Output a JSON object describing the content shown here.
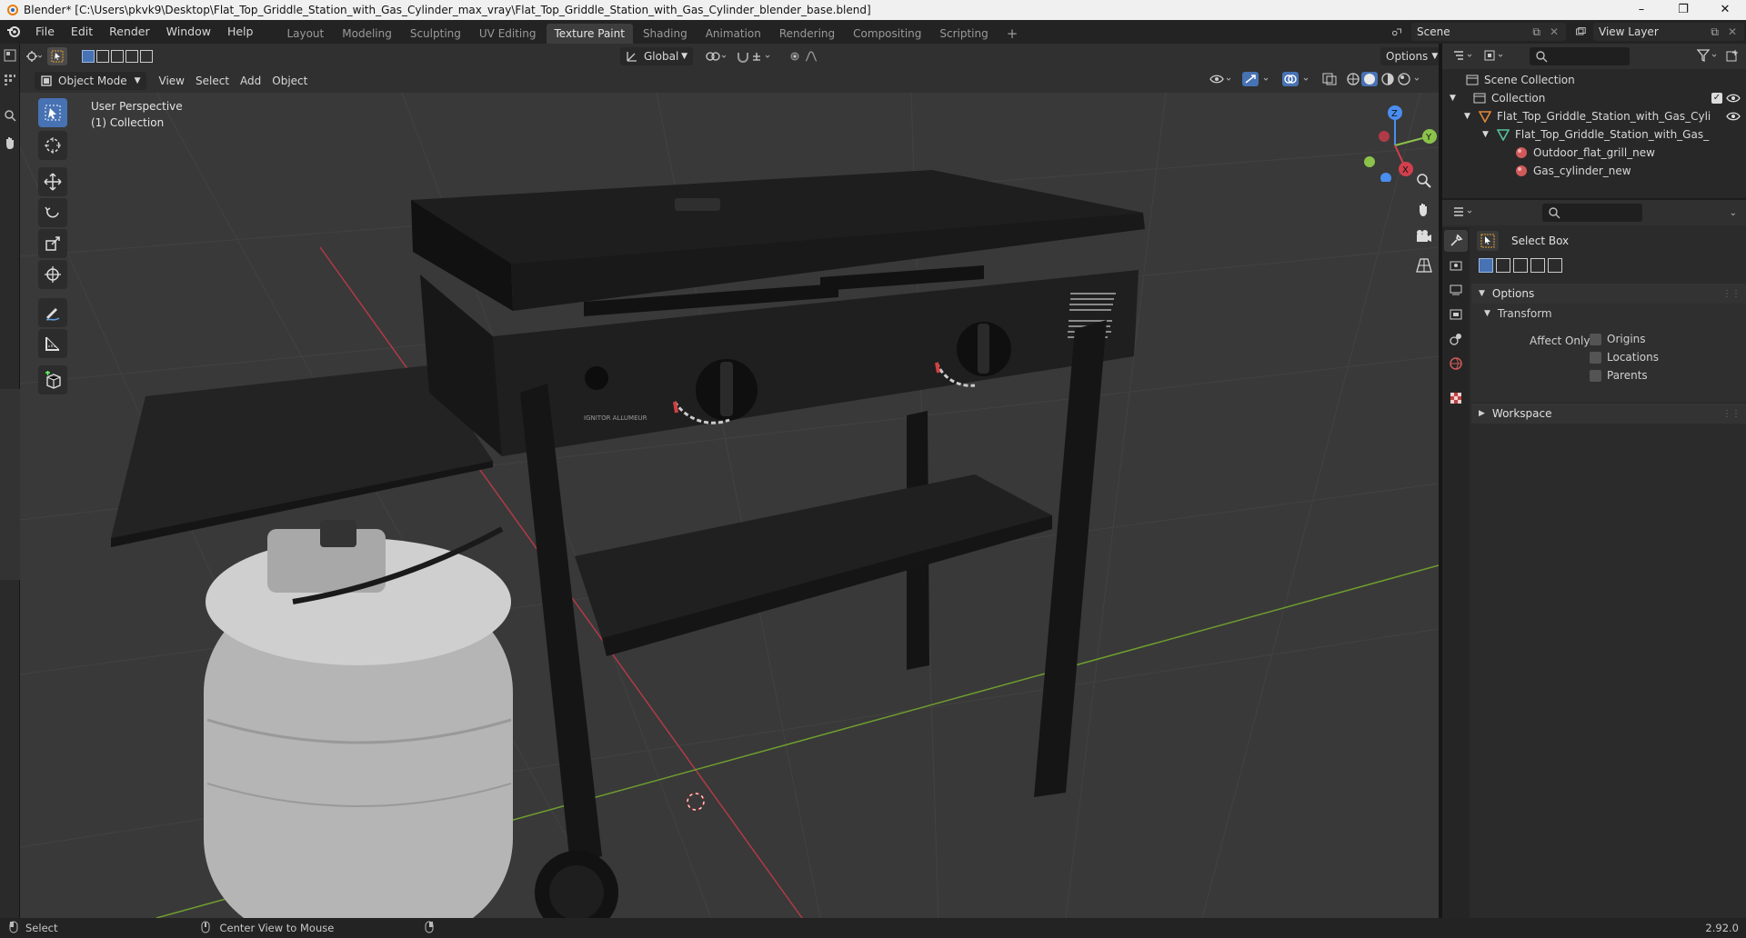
{
  "window": {
    "title": "Blender* [C:\\Users\\pkvk9\\Desktop\\Flat_Top_Griddle_Station_with_Gas_Cylinder_max_vray\\Flat_Top_Griddle_Station_with_Gas_Cylinder_blender_base.blend]",
    "minimize": "–",
    "maximize": "❐",
    "close": "✕"
  },
  "menu": [
    "File",
    "Edit",
    "Render",
    "Window",
    "Help"
  ],
  "workspaces": [
    {
      "label": "Layout"
    },
    {
      "label": "Modeling"
    },
    {
      "label": "Sculpting"
    },
    {
      "label": "UV Editing"
    },
    {
      "label": "Texture Paint",
      "active": true
    },
    {
      "label": "Shading"
    },
    {
      "label": "Animation"
    },
    {
      "label": "Rendering"
    },
    {
      "label": "Compositing"
    },
    {
      "label": "Scripting"
    }
  ],
  "add_workspace": "+",
  "scene": {
    "name": "Scene",
    "view_layer": "View Layer"
  },
  "viewport": {
    "transform_orientation": "Global",
    "options_label": "Options",
    "mode": "Object Mode",
    "menus": [
      "View",
      "Select",
      "Add",
      "Object"
    ],
    "overlay_title": "User Perspective",
    "overlay_collection": "(1) Collection",
    "gizmo": {
      "x": "X",
      "y": "Y",
      "z": "Z"
    },
    "label_sticker": "IGNITOR ALLUMEUR"
  },
  "outliner": {
    "root": "Scene Collection",
    "collection": "Collection",
    "object": "Flat_Top_Griddle_Station_with_Gas_Cyli",
    "mesh": "Flat_Top_Griddle_Station_with_Gas_",
    "materials": [
      "Outdoor_flat_grill_new",
      "Gas_cylinder_new"
    ]
  },
  "properties": {
    "tool_name": "Select Box",
    "options_header": "Options",
    "transform_header": "Transform",
    "affect_only_label": "Affect Only",
    "affect_only": [
      "Origins",
      "Locations",
      "Parents"
    ],
    "workspace_header": "Workspace"
  },
  "statusbar": {
    "select": "Select",
    "center_view": "Center View to Mouse",
    "version": "2.92.0"
  },
  "colors": {
    "accent": "#4772b3",
    "axis_x": "#d2404d",
    "axis_y": "#8bc34a",
    "axis_z": "#4a8ef0",
    "object_orange": "#e0883a",
    "mesh_green": "#55c0a0",
    "material_red": "#d05a5a"
  }
}
